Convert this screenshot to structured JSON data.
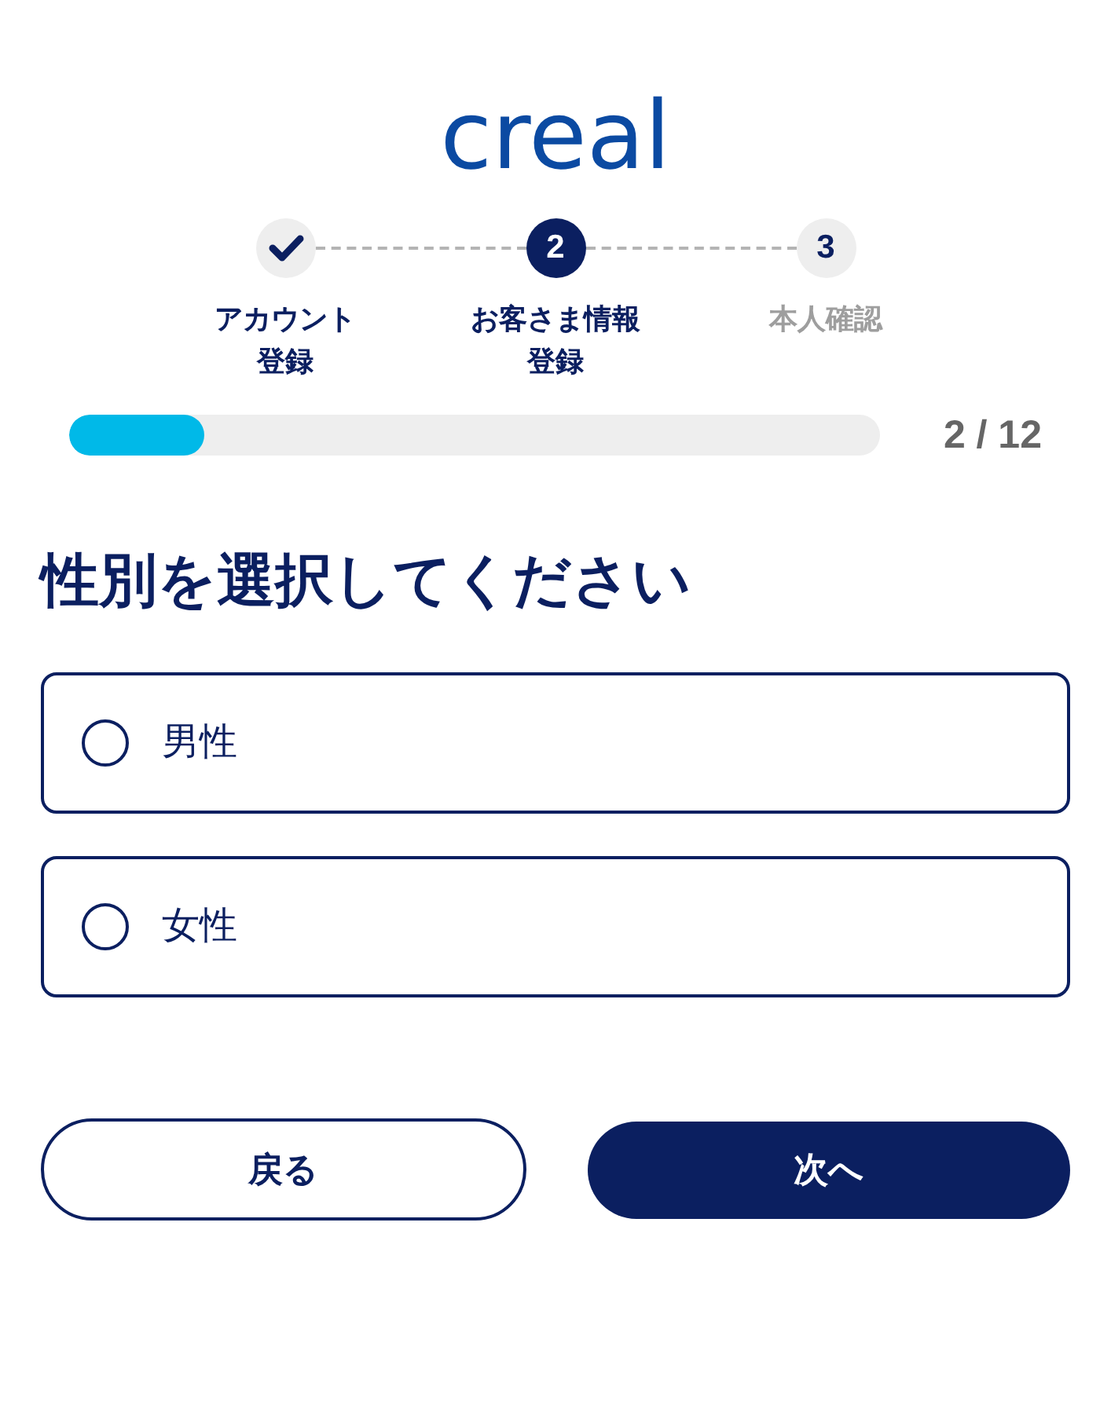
{
  "logo": "creal",
  "steps": [
    {
      "label_lines": [
        "アカウント",
        "登録"
      ],
      "completed": true,
      "selected": false
    },
    {
      "number": "2",
      "label_lines": [
        "お客さま情報",
        "登録"
      ],
      "completed": false,
      "selected": true
    },
    {
      "number": "3",
      "label_lines": [
        "本人確認"
      ],
      "completed": false,
      "selected": false
    }
  ],
  "progress": {
    "level": 0.1667,
    "reading": "2 / 12"
  },
  "question": "性別を選択してください",
  "options": [
    {
      "label": "男性",
      "selected": false
    },
    {
      "label": "女性",
      "selected": false
    }
  ],
  "buttons": [
    {
      "label": "戻る",
      "kind": "secondary"
    },
    {
      "label": "次へ",
      "kind": "primary"
    }
  ]
}
